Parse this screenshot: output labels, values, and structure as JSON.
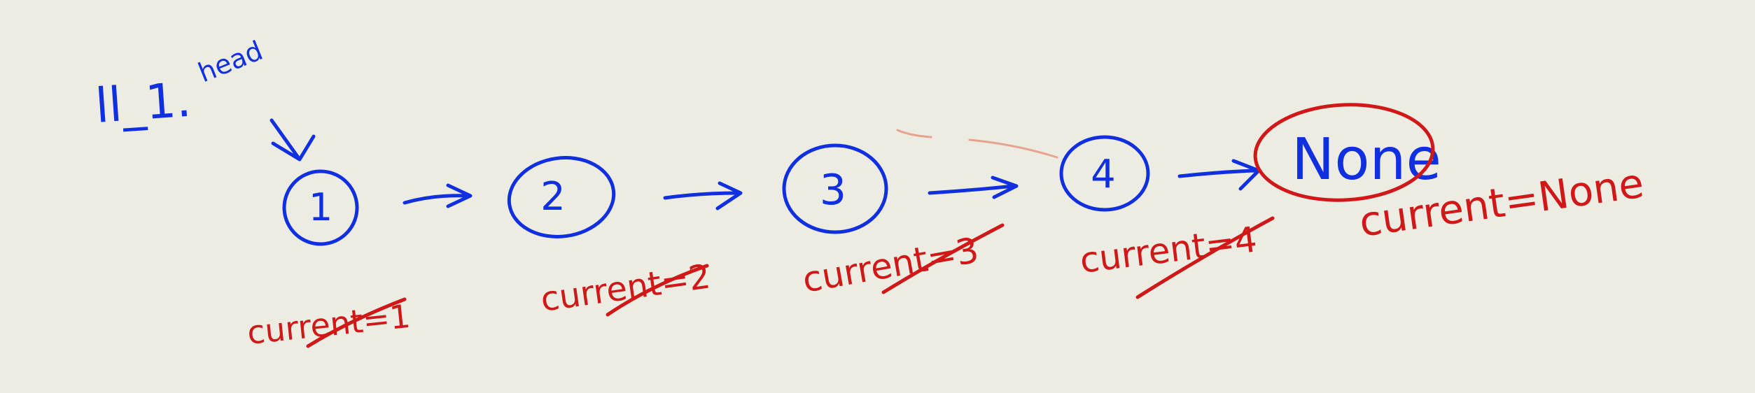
{
  "diagram": {
    "list_label": "ll_1.",
    "head_label": "head",
    "nodes": [
      {
        "label": "1"
      },
      {
        "label": "2"
      },
      {
        "label": "3"
      },
      {
        "label": "4"
      }
    ],
    "terminal": {
      "label": "None"
    },
    "current_annotations": [
      {
        "text": "current=1",
        "struck": true
      },
      {
        "text": "current=2",
        "struck": true
      },
      {
        "text": "current=3",
        "struck": true
      },
      {
        "text": "current=4",
        "struck": true
      },
      {
        "text": "current=None",
        "struck": false
      }
    ],
    "colors": {
      "background": "#ecece3",
      "node_ink": "#1030e0",
      "annotation_ink": "#d01818"
    }
  }
}
